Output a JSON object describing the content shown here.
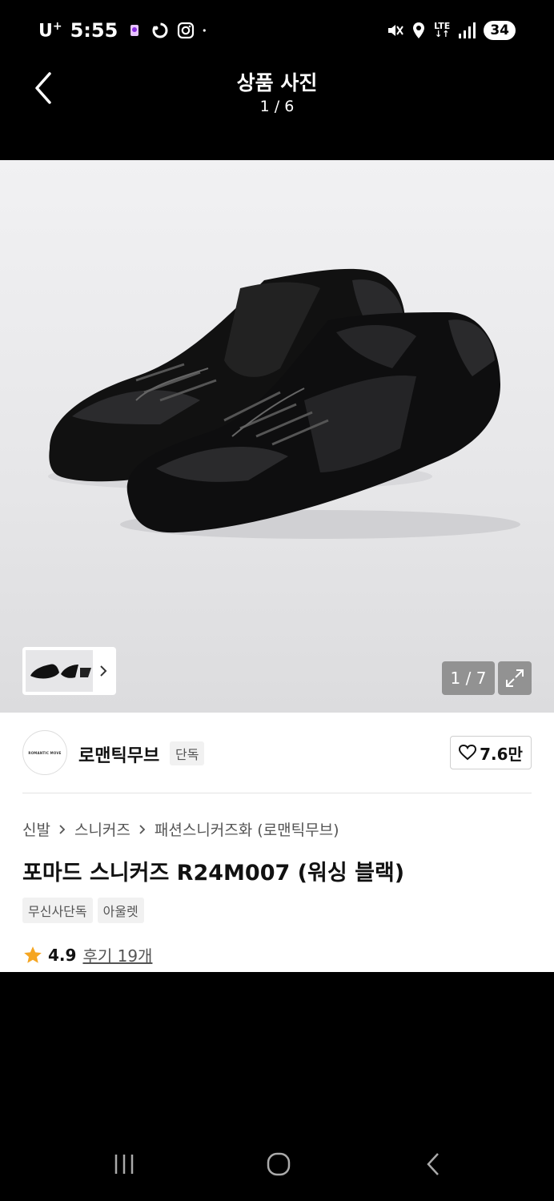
{
  "status_bar": {
    "carrier": "U",
    "carrier_sup": "+",
    "time": "5:55",
    "network": "LTE",
    "battery": "34"
  },
  "header": {
    "title": "상품 사진",
    "page_indicator": "1 / 6"
  },
  "photo": {
    "counter": "1 / 7"
  },
  "brand": {
    "logo_text": "ROMANTIC MOVE",
    "name": "로맨틱무브",
    "badge": "단독"
  },
  "like": {
    "count": "7.6만"
  },
  "breadcrumb": [
    "신발",
    "스니커즈",
    "패션스니커즈화 (로맨틱무브)"
  ],
  "product": {
    "title": "포마드 스니커즈 R24M007 (워싱 블랙)",
    "tags": [
      "무신사단독",
      "아울렛"
    ]
  },
  "rating": {
    "score": "4.9",
    "reviews": "후기 19개"
  },
  "colors": {
    "star": "#f5a623",
    "background": "#000000"
  }
}
